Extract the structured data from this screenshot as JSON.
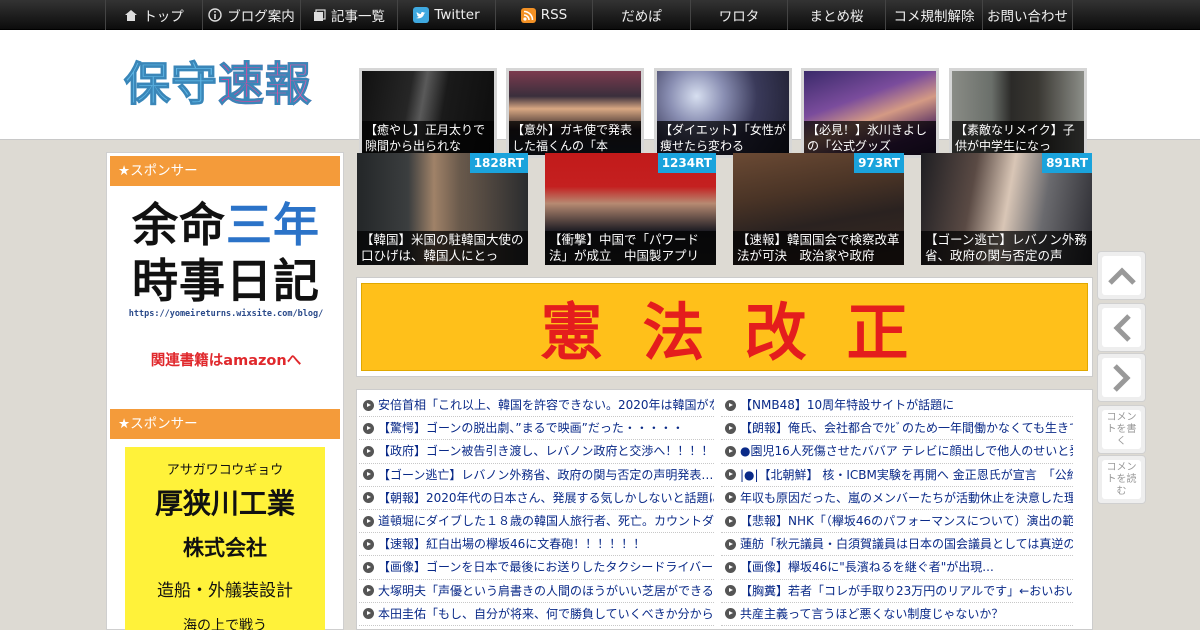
{
  "nav": {
    "items": [
      {
        "label": "トップ",
        "icon": "home-icon"
      },
      {
        "label": "ブログ案内",
        "icon": "info-icon"
      },
      {
        "label": "記事一覧",
        "icon": "list-icon"
      },
      {
        "label": "Twitter",
        "icon": "twitter-icon"
      },
      {
        "label": "RSS",
        "icon": "rss-icon"
      },
      {
        "label": "だめぽ"
      },
      {
        "label": "ワロタ"
      },
      {
        "label": "まとめ桜"
      },
      {
        "label": "コメ規制解除"
      },
      {
        "label": "お問い合わせ"
      }
    ]
  },
  "header": {
    "logo": "保守速報",
    "thumbs": [
      {
        "caption": "【癒やし】正月太りで隙間から出られな"
      },
      {
        "caption": "【意外】ガキ使で発表した福くんの「本"
      },
      {
        "caption": "【ダイエット】「女性が痩せたら変わる"
      },
      {
        "caption": "【必見！】氷川きよしの「公式グッズ"
      },
      {
        "caption": "【素敵なリメイク】子供が中学生になっ"
      }
    ]
  },
  "sidebar": {
    "sponsor_heading_1": "★スポンサー",
    "sponsor_heading_2": "★スポンサー",
    "ad1": {
      "line1a": "余命",
      "line1b": "三年",
      "line2": "時事日記",
      "url": "https://yomeireturns.wixsite.com/blog/",
      "amazon": "関連書籍はamazonへ"
    },
    "ad2": {
      "kana": "アサガワコウギョウ",
      "name1": "厚狭川工業",
      "name2": "株式会社",
      "line3": "造船・外艤装設計",
      "line4": "海の上で戦う"
    }
  },
  "ranking": [
    {
      "rt": "1828RT",
      "caption": "【韓国】米国の駐韓国大使の口ひげは、韓国人にとっ"
    },
    {
      "rt": "1234RT",
      "caption": "【衝撃】中国で「パワード法」が成立　中国製アプリ"
    },
    {
      "rt": "973RT",
      "caption": "【速報】韓国国会で検察改革法が可決　政治家や政府"
    },
    {
      "rt": "891RT",
      "caption": "【ゴーン逃亡】レバノン外務省、政府の関与否定の声"
    }
  ],
  "banner": {
    "text": "憲法改正"
  },
  "news": {
    "left": [
      "安倍首相「これ以上、韓国を許容できない。2020年は韓国がな",
      "【驚愕】ゴーンの脱出劇、”まるで映画”だった・・・・・",
      "【政府】ゴーン被告引き渡し、レバノン政府と交渉へ！！！！",
      "【ゴーン逃亡】レバノン外務省、政府の関与否定の声明発表…",
      "【朝報】2020年代の日本さん、発展する気しかしないと話題に",
      "道頓堀にダイブした１８歳の韓国人旅行者、死亡。カウントダ",
      "【速報】紅白出場の欅坂46に文春砲！！！！！！",
      "【画像】ゴーンを日本で最後にお送りしたタクシードライバー",
      "大塚明夫「声優という肩書きの人間のほうがいい芝居ができる",
      "本田圭佑「もし、自分が将来、何で勝負していくべきか分から"
    ],
    "right": [
      "【NMB48】10周年特設サイトが話題に",
      "【朗報】俺氏、会社都合でｸﾋﾞのため一年間働かなくても生きて",
      "●園児16人死傷させたババア テレビに顔出しで他人のせいと発",
      "|●|【北朝鮮】 核・ICBM実験を再開へ 金正恩氏が宣言　「公約",
      "年収も原因だった、嵐のメンバーたちが活動休止を決意した理",
      "【悲報】NHK「（欅坂46のパフォーマンスについて）演出の範",
      "蓮舫「秋元議員・白須賀議員は日本の国会議員としては真逆の",
      "【画像】欅坂46に\"長濱ねるを継ぐ者\"が出現...",
      "【胸糞】若者「コレが手取り23万円のリアルです」←おいおい",
      "共産主義って言うほど悪くない制度じゃないか？"
    ]
  },
  "side_buttons": {
    "write_comment": "コメントを書く",
    "read_comment": "コメントを読む"
  }
}
